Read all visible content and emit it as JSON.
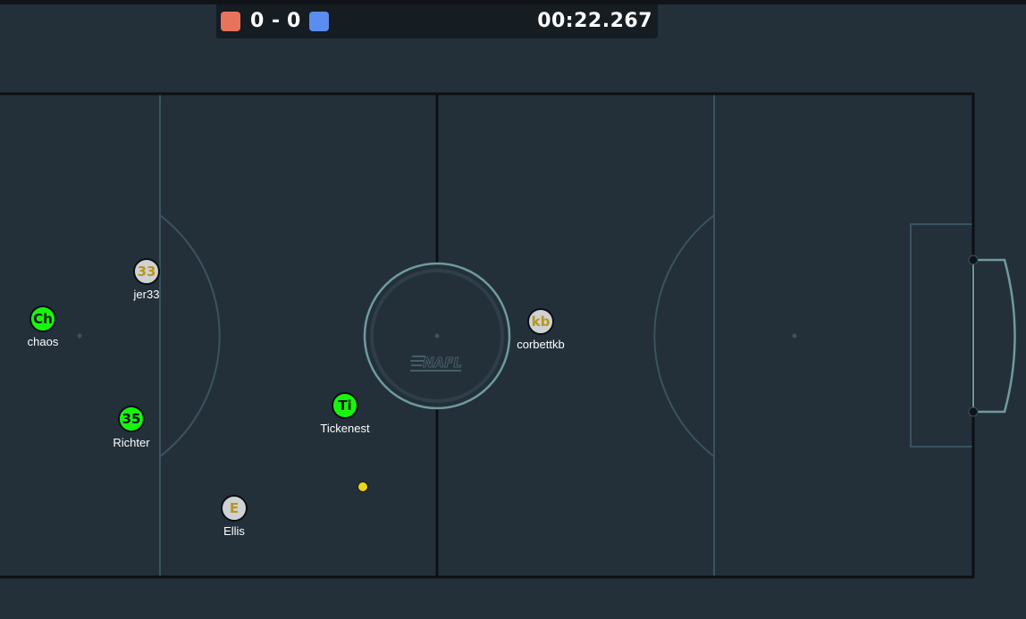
{
  "scoreboard": {
    "red_color": "#e8735c",
    "blue_color": "#5b8def",
    "red_score": "0",
    "separator": "-",
    "blue_score": "0",
    "timer": "00:22.267"
  },
  "field": {
    "line_color": "#3b5360",
    "border_color": "#0c0f12",
    "center_circle_color": "#6f9aa0",
    "goal_color": "#6f9aa0",
    "logo_icon": "nafl-logo-icon"
  },
  "players": [
    {
      "initials": "33",
      "name": "jer33",
      "team": "grey"
    },
    {
      "initials": "Ch",
      "name": "chaos",
      "team": "green"
    },
    {
      "initials": "35",
      "name": "Richter",
      "team": "green"
    },
    {
      "initials": "Ti",
      "name": "Tickenest",
      "team": "green"
    },
    {
      "initials": "E",
      "name": "Ellis",
      "team": "grey"
    },
    {
      "initials": "kb",
      "name": "corbettkb",
      "team": "grey"
    }
  ],
  "ball": {
    "color": "#e8d51e"
  }
}
